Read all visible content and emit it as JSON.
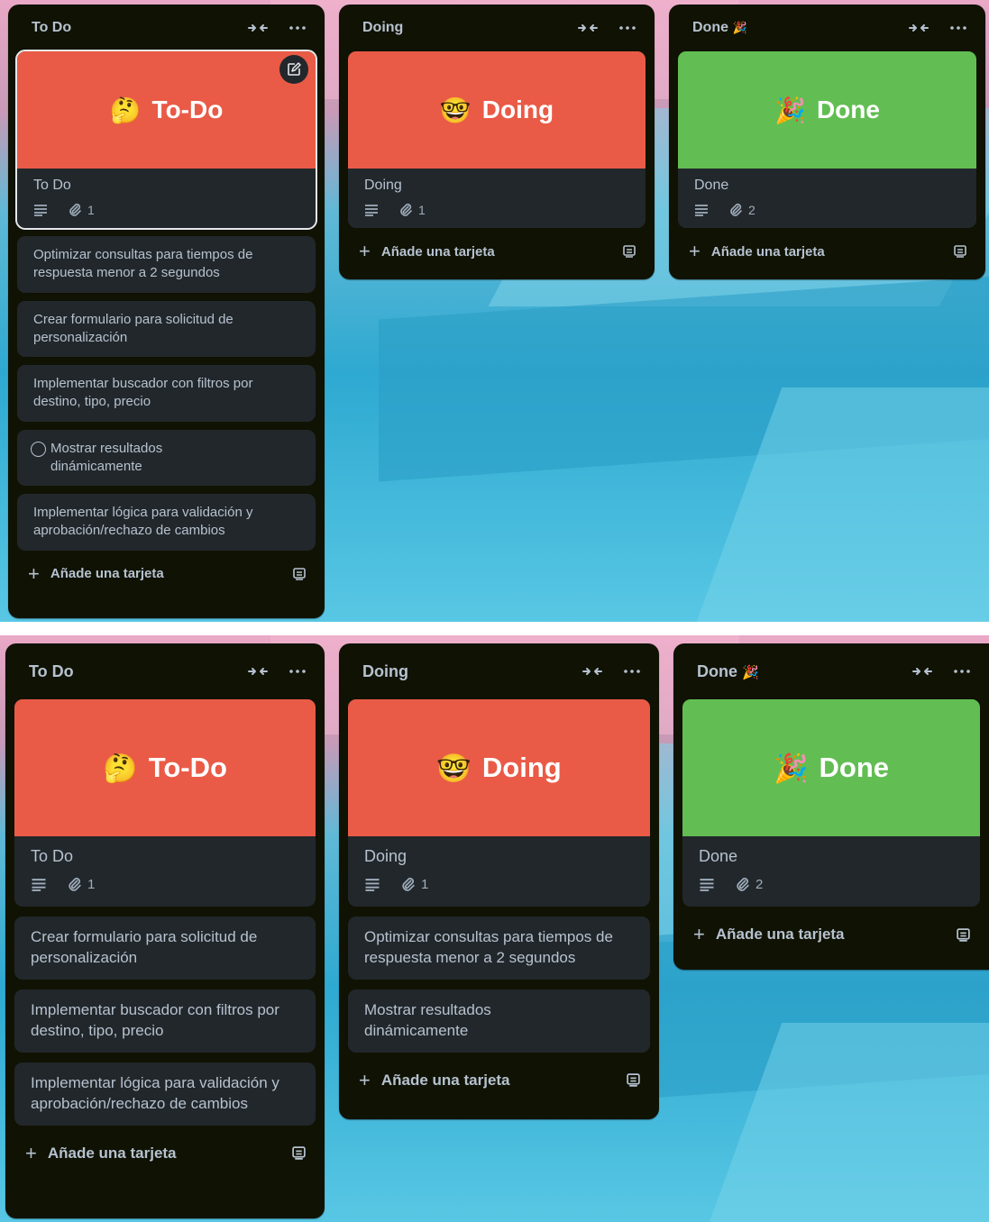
{
  "colors": {
    "list_bg": "#101204",
    "card_bg": "#22272b",
    "text": "#b6c2cf",
    "cover_red": "#e95b47",
    "cover_green": "#62be53"
  },
  "panel_a": {
    "todo": {
      "title": "To Do",
      "cover_emoji": "🤔",
      "cover_text": "To-Do",
      "card_name": "To Do",
      "attachments": "1",
      "tasks": [
        "Optimizar consultas para tiempos de respuesta menor a 2 segundos",
        "Crear formulario para solicitud de personalización",
        "Implementar buscador con filtros por destino, tipo, precio",
        "Mostrar resultados dinámicamente",
        "Implementar lógica para validación y aprobación/rechazo de cambios"
      ],
      "add_label": "Añade una tarjeta"
    },
    "doing": {
      "title": "Doing",
      "cover_emoji": "🤓",
      "cover_text": "Doing",
      "card_name": "Doing",
      "attachments": "1",
      "add_label": "Añade una tarjeta"
    },
    "done": {
      "title": "Done",
      "title_emoji": "🎉",
      "cover_emoji": "🎉",
      "cover_text": "Done",
      "card_name": "Done",
      "attachments": "2",
      "add_label": "Añade una tarjeta"
    }
  },
  "panel_b": {
    "todo": {
      "title": "To Do",
      "cover_emoji": "🤔",
      "cover_text": "To-Do",
      "card_name": "To Do",
      "attachments": "1",
      "tasks": [
        "Crear formulario para solicitud de personalización",
        "Implementar buscador con filtros por destino, tipo, precio",
        "Implementar lógica para validación y aprobación/rechazo de cambios"
      ],
      "add_label": "Añade una tarjeta"
    },
    "doing": {
      "title": "Doing",
      "cover_emoji": "🤓",
      "cover_text": "Doing",
      "card_name": "Doing",
      "attachments": "1",
      "tasks": [
        "Optimizar consultas para tiempos de respuesta menor a 2 segundos",
        "Mostrar resultados dinámicamente"
      ],
      "add_label": "Añade una tarjeta"
    },
    "done": {
      "title": "Done",
      "title_emoji": "🎉",
      "cover_emoji": "🎉",
      "cover_text": "Done",
      "card_name": "Done",
      "attachments": "2",
      "add_label": "Añade una tarjeta"
    }
  },
  "icons": {
    "collapse": "collapse-icon",
    "more": "more-icon",
    "description": "description-icon",
    "attachment": "paperclip-icon",
    "edit": "edit-icon",
    "plus": "plus-icon",
    "template": "template-icon",
    "complete": "complete-circle-icon"
  }
}
